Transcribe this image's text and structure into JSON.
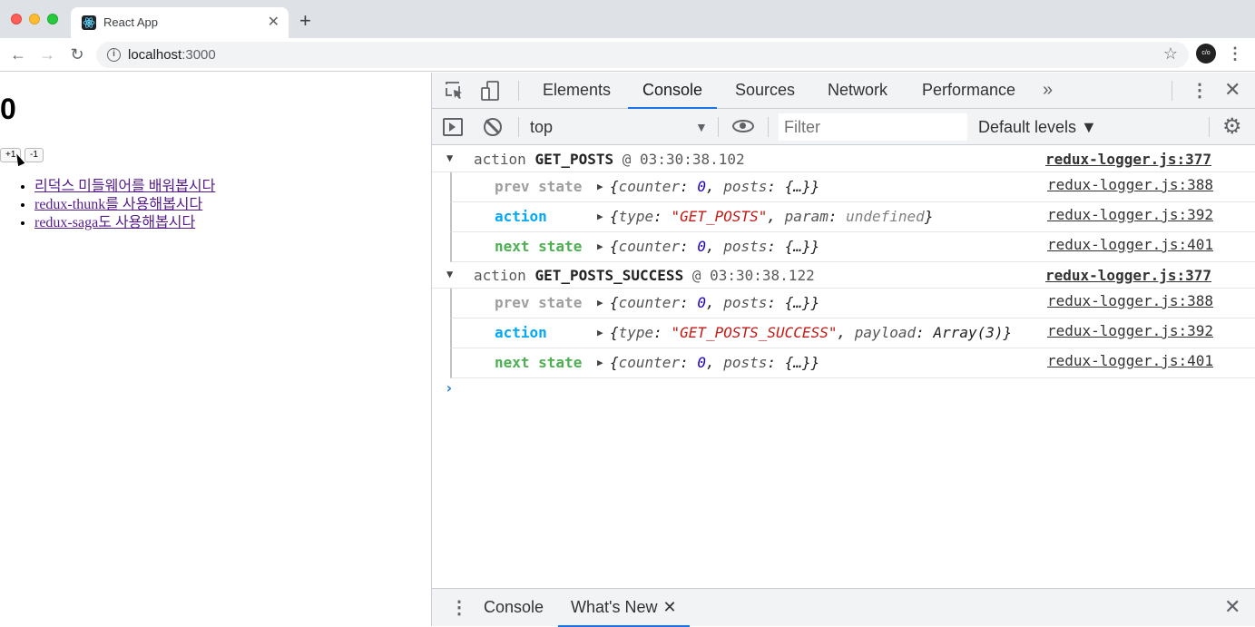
{
  "browser": {
    "tab_title": "React App",
    "tab_close": "✕",
    "new_tab": "+",
    "url_host": "localhost",
    "url_port": ":3000",
    "profile_initials": "c/o"
  },
  "page": {
    "counter": "0",
    "plus_label": "+1",
    "minus_label": "-1",
    "posts": [
      "리덕스 미들웨어를 배워봅시다",
      "redux-thunk를 사용해봅시다",
      "redux-saga도 사용해봅시다"
    ]
  },
  "devtools": {
    "tabs": [
      "Elements",
      "Console",
      "Sources",
      "Network",
      "Performance"
    ],
    "active_tab": "Console",
    "context": "top",
    "filter_placeholder": "Filter",
    "levels": "Default levels ▼",
    "console": {
      "groups": [
        {
          "prefix": "action",
          "type": "GET_POSTS",
          "time": "@ 03:30:38.102",
          "source": "redux-logger.js:377",
          "rows": [
            {
              "label": "prev state",
              "color": "#9e9e9e",
              "source": "redux-logger.js:388"
            },
            {
              "label": "action",
              "color": "#03a9f4",
              "source": "redux-logger.js:392"
            },
            {
              "label": "next state",
              "color": "#4caf50",
              "source": "redux-logger.js:401"
            }
          ],
          "prev_obj": {
            "counter_val": "0",
            "posts_val": "{…}"
          },
          "action_obj": {
            "type_val": "\"GET_POSTS\"",
            "extra_key": "param",
            "extra_val": "undefined"
          },
          "next_obj": {
            "counter_val": "0",
            "posts_val": "{…}"
          }
        },
        {
          "prefix": "action",
          "type": "GET_POSTS_SUCCESS",
          "time": "@ 03:30:38.122",
          "source": "redux-logger.js:377",
          "rows": [
            {
              "label": "prev state",
              "color": "#9e9e9e",
              "source": "redux-logger.js:388"
            },
            {
              "label": "action",
              "color": "#03a9f4",
              "source": "redux-logger.js:392"
            },
            {
              "label": "next state",
              "color": "#4caf50",
              "source": "redux-logger.js:401"
            }
          ],
          "prev_obj": {
            "counter_val": "0",
            "posts_val": "{…}"
          },
          "action_obj": {
            "type_val": "\"GET_POSTS_SUCCESS\"",
            "extra_key": "payload",
            "extra_val": "Array(3)"
          },
          "next_obj": {
            "counter_val": "0",
            "posts_val": "{…}"
          }
        }
      ],
      "prompt": "›"
    },
    "drawer": {
      "tabs": [
        "Console",
        "What's New"
      ]
    }
  }
}
